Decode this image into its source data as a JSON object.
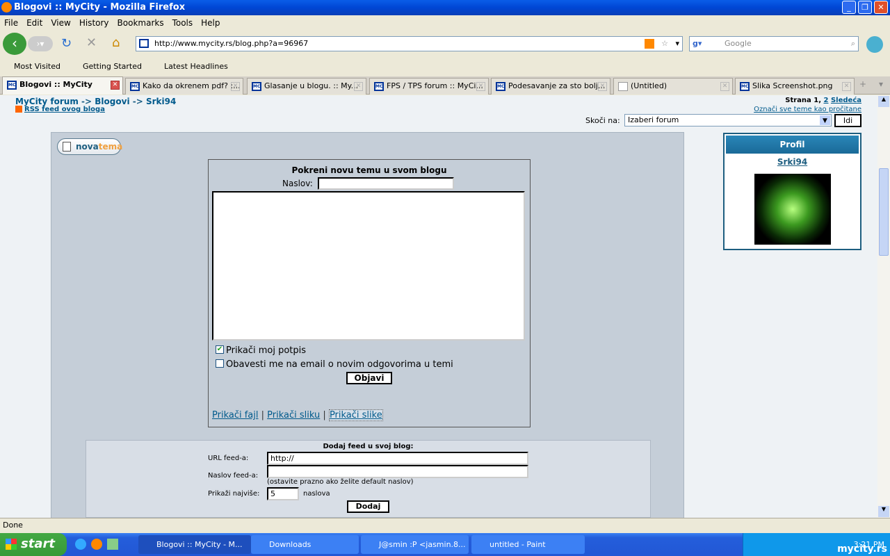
{
  "window": {
    "title": "Blogovi :: MyCity - Mozilla Firefox"
  },
  "menu": [
    "File",
    "Edit",
    "View",
    "History",
    "Bookmarks",
    "Tools",
    "Help"
  ],
  "nav": {
    "url": "http://www.mycity.rs/blog.php?a=96967",
    "search_placeholder": "Google"
  },
  "bookmarks": [
    "Most Visited",
    "Getting Started",
    "Latest Headlines"
  ],
  "tabs": [
    "Blogovi :: MyCity",
    "Kako da okrenem pdf? :...",
    "Glasanje u blogu. :: My...",
    "FPS / TPS forum :: MyCi...",
    "Podesavanje za sto bolj...",
    "(Untitled)",
    "Slika Screenshot.png"
  ],
  "page": {
    "breadcrumb": [
      "MyCity forum",
      "->",
      "Blogovi",
      "->",
      "Srki94"
    ],
    "rss_link": "RSS feed ovog bloga",
    "pagination": {
      "label": "Strana 1,",
      "page2": "2",
      "next": "Sledeća"
    },
    "mark_read": "Označi sve teme kao pročitane",
    "jump": {
      "label": "Skoči na:",
      "selected": "Izaberi forum",
      "go": "Idi"
    },
    "new_topic_button": {
      "part1": "nova",
      "part2": "tema"
    },
    "form": {
      "title": "Pokreni novu temu u svom blogu",
      "title_label": "Naslov:",
      "title_value": "",
      "body_value": "",
      "attach_signature": "Prikači moj potpis",
      "attach_signature_checked": true,
      "notify": "Obavesti me na email o novim odgovorima u temi",
      "notify_checked": false,
      "submit": "Objavi",
      "links": [
        "Prikači fajl",
        "Prikači sliku",
        "Prikači slike"
      ],
      "sep": "|"
    },
    "feed": {
      "title": "Dodaj feed u svoj blog:",
      "url_label": "URL feed-a:",
      "url_value": "http://",
      "name_label": "Naslov feed-a:",
      "name_value": "",
      "hint": "(ostavite prazno ako želite default naslov)",
      "max_label": "Prikaži najviše:",
      "max_value": "5",
      "max_suffix": "naslova",
      "submit": "Dodaj"
    },
    "profile": {
      "header": "Profil",
      "username": "Srki94",
      "avatar": "biohazard-avatar"
    }
  },
  "status": "Done",
  "taskbar": {
    "start": "start",
    "tasks": [
      "Blogovi :: MyCity - M...",
      "Downloads",
      "J@smin :P <jasmin.8...",
      "untitled - Paint"
    ],
    "clock": "3:21 PM",
    "watermark": "mycity.rs"
  }
}
